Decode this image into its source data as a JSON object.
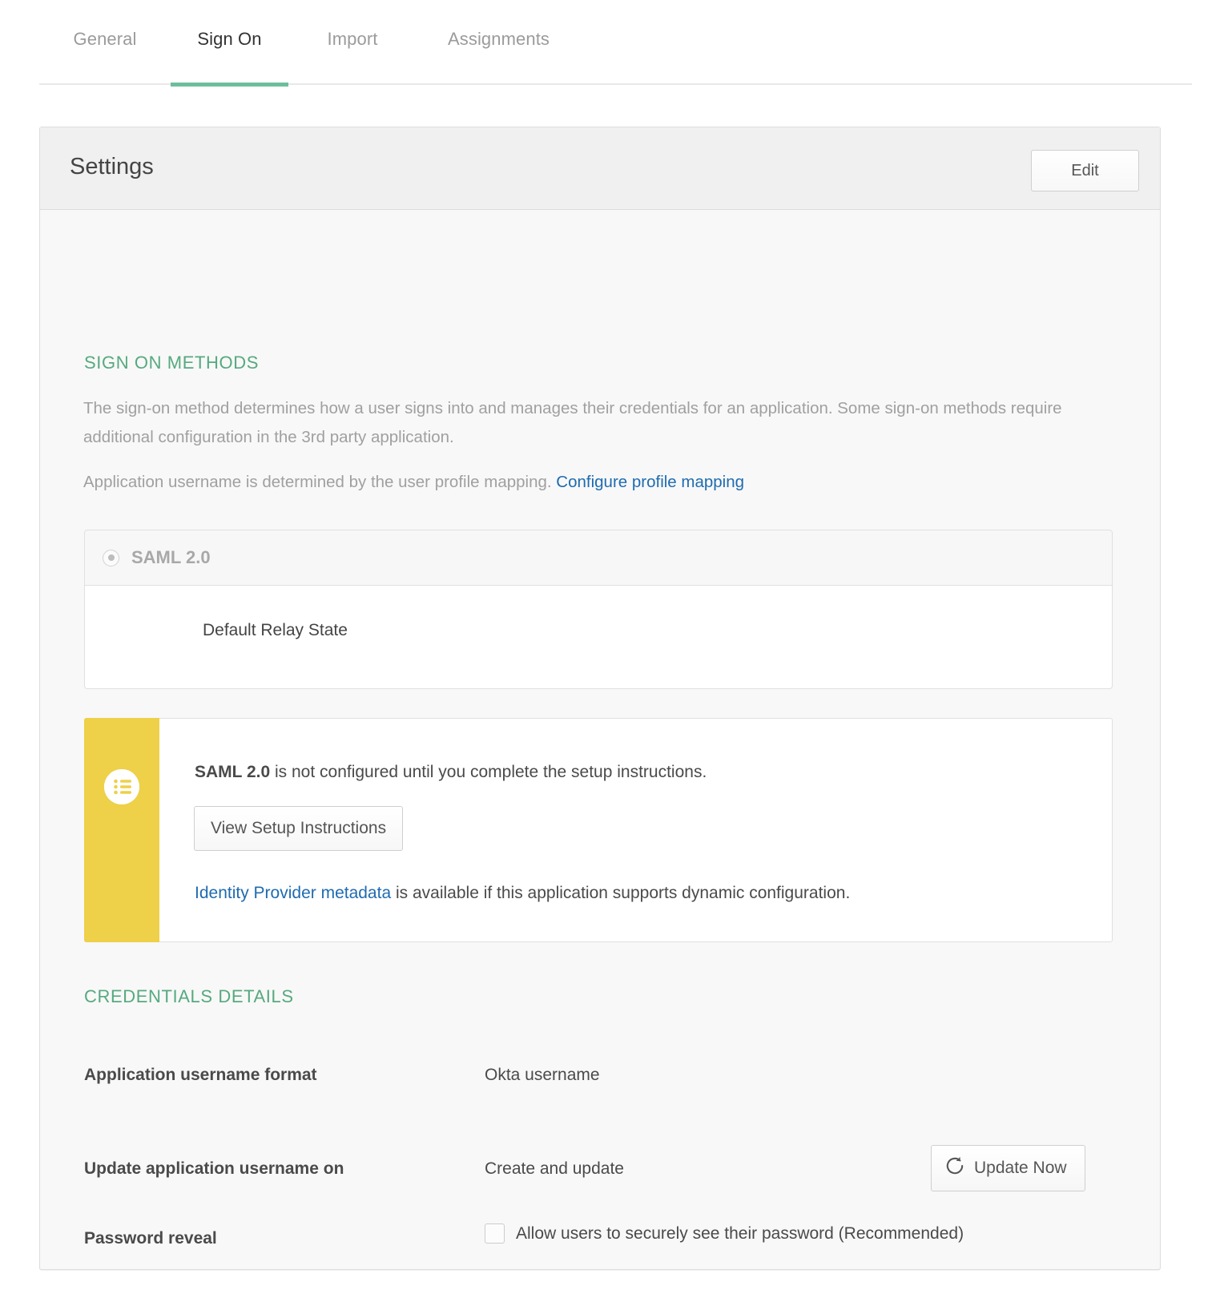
{
  "tabs": [
    {
      "label": "General",
      "active": false
    },
    {
      "label": "Sign On",
      "active": true
    },
    {
      "label": "Import",
      "active": false
    },
    {
      "label": "Assignments",
      "active": false
    }
  ],
  "card": {
    "title": "Settings",
    "edit_label": "Edit"
  },
  "sign_on_methods": {
    "heading": "SIGN ON METHODS",
    "description": "The sign-on method determines how a user signs into and manages their credentials for an application. Some sign-on methods require additional configuration in the 3rd party application.",
    "mapping_text_prefix": "Application username is determined by the user profile mapping. ",
    "mapping_link": "Configure profile mapping",
    "method": {
      "label": "SAML 2.0",
      "selected": true,
      "relay_state_label": "Default Relay State"
    }
  },
  "callout": {
    "icon": "list-icon",
    "bar_color": "#eed049",
    "message_bold": "SAML 2.0",
    "message_rest": " is not configured until you complete the setup instructions.",
    "setup_button": "View Setup Instructions",
    "metadata_link": "Identity Provider metadata",
    "metadata_rest": " is available if this application supports dynamic configuration."
  },
  "credentials": {
    "heading": "CREDENTIALS DETAILS",
    "rows": [
      {
        "label": "Application username format",
        "value": "Okta username"
      },
      {
        "label": "Update application username on",
        "value": "Create and update"
      },
      {
        "label": "Password reveal",
        "value": ""
      }
    ],
    "update_button": "Update Now",
    "update_button_icon": "refresh-icon",
    "password_reveal_checkbox_label": "Allow users to securely see their password (Recommended)",
    "password_reveal_checked": false
  },
  "colors": {
    "accent_green": "#6cbf9c",
    "section_green": "#56a97f",
    "link_blue": "#1f6bb0",
    "callout_yellow": "#eed049",
    "card_header_gray": "#f0f0f0",
    "card_body_gray": "#f8f8f8"
  }
}
